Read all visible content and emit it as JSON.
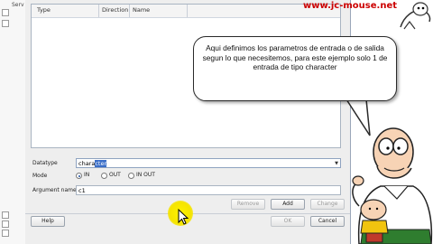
{
  "sidebar": {
    "label": "Serv"
  },
  "watermark": "www.jc-mouse.net",
  "table": {
    "columns": [
      "Type",
      "Direction",
      "Name"
    ]
  },
  "form": {
    "datatype_label": "Datatype",
    "datatype_value_prefix": "chara",
    "datatype_value_selected": "cter",
    "mode_label": "Mode",
    "mode_options": [
      "IN",
      "OUT",
      "IN OUT"
    ],
    "mode_selected": "IN",
    "argname_label": "Argument name",
    "argname_value": "c1"
  },
  "buttons": {
    "remove": "Remove",
    "add": "Add",
    "change": "Change",
    "help": "Help",
    "ok": "OK",
    "cancel": "Cancel"
  },
  "callout": {
    "text": "Aqui definimos los parametros de entrada o de salida segun lo que necesitemos, para este ejemplo solo 1 de entrada de tipo character"
  }
}
